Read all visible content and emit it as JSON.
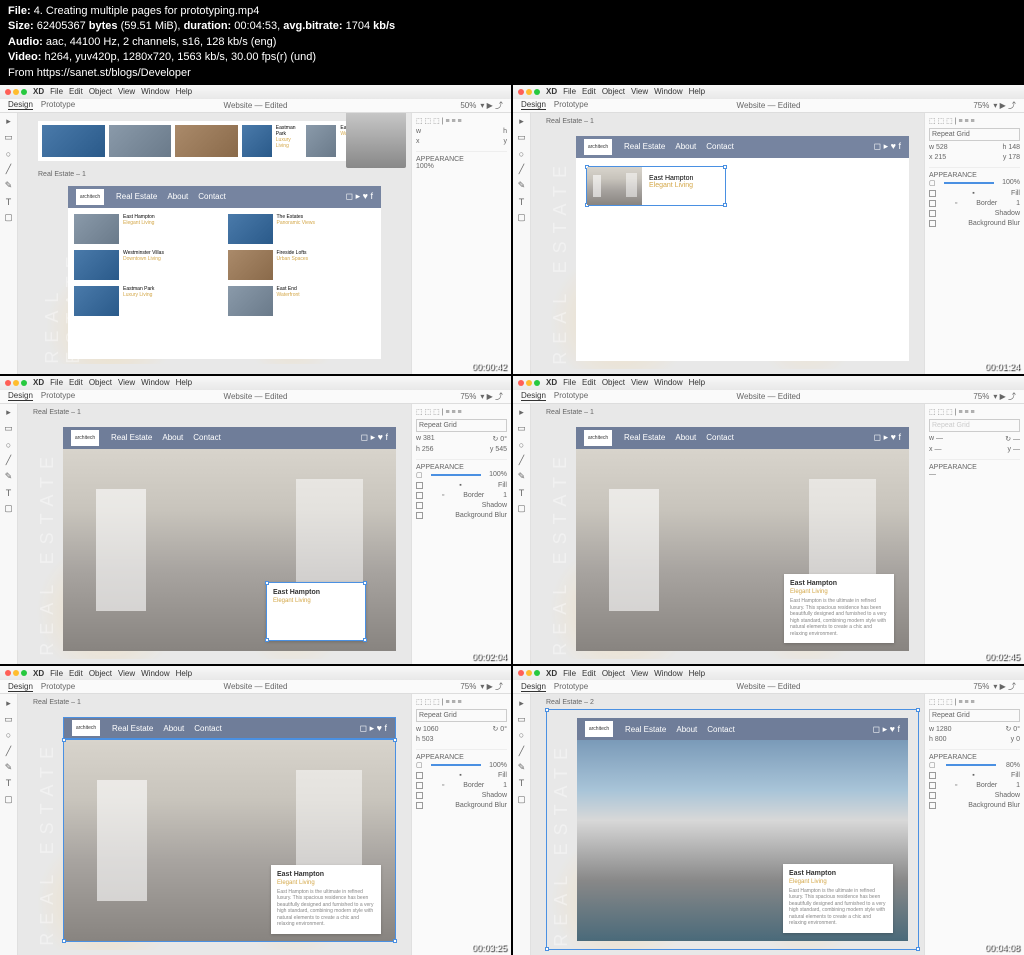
{
  "header": {
    "file_label": "File:",
    "file_name": "4. Creating multiple pages for prototyping.mp4",
    "size_label": "Size:",
    "size_bytes": "62405367",
    "size_unit": "bytes",
    "size_mib": "(59.51 MiB),",
    "duration_label": "duration:",
    "duration": "00:04:53,",
    "bitrate_label": "avg.bitrate:",
    "bitrate": "1704",
    "bitrate_unit": "kb/s",
    "audio_label": "Audio:",
    "audio": "aac, 44100 Hz, 2 channels, s16, 128 kb/s (eng)",
    "video_label": "Video:",
    "video": "h264, yuv420p, 1280x720, 1563 kb/s, 30.00 fps(r) (und)",
    "from": "From https://sanet.st/blogs/Developer"
  },
  "menus": [
    "XD",
    "File",
    "Edit",
    "Object",
    "View",
    "Window",
    "Help"
  ],
  "app": {
    "tab_design": "Design",
    "tab_prototype": "Prototype",
    "title": "Website — Edited"
  },
  "nav": {
    "logo": "architech",
    "links": [
      "Real Estate",
      "About",
      "Contact"
    ]
  },
  "sidebar_text": "REAL ESTATE",
  "card": {
    "title": "East Hampton",
    "subtitle": "Elegant Living",
    "desc": "East Hampton is the ultimate in refined luxury. This spacious residence has been beautifully designed and furnished to a very high standard, combining modern style with natural elements to create a chic and relaxing environment."
  },
  "props": {
    "repeat": "Repeat Grid",
    "appearance": "APPEARANCE",
    "opacity": "100%",
    "fill": "Fill",
    "border": "Border",
    "shadow": "Shadow",
    "blur": "Background Blur"
  },
  "panels": [
    {
      "zoom": "50%",
      "artboard": "Real Estate – 1",
      "ts": "00:00:42",
      "w": "",
      "h": ""
    },
    {
      "zoom": "75%",
      "artboard": "Real Estate – 1",
      "ts": "00:01:24",
      "w": "528",
      "h": "148",
      "x": "215",
      "y": "178"
    },
    {
      "zoom": "75%",
      "artboard": "Real Estate – 1",
      "ts": "00:02:04",
      "w": "381",
      "h": "256",
      "y2": "545"
    },
    {
      "zoom": "75%",
      "artboard": "Real Estate – 1",
      "ts": "00:02:45"
    },
    {
      "zoom": "75%",
      "artboard": "Real Estate – 1",
      "ts": "00:03:25",
      "w": "1060",
      "h": "503"
    },
    {
      "zoom": "75%",
      "artboard": "Real Estate – 2",
      "ts": "00:04:08",
      "w": "1280",
      "h": "800"
    }
  ],
  "grid_items": [
    {
      "name": "East Hampton",
      "sub": "Elegant Living"
    },
    {
      "name": "The Estates",
      "sub": "Panoramic Views"
    },
    {
      "name": "Westminster Villas",
      "sub": "Downtown Living"
    },
    {
      "name": "Fireside Lofts",
      "sub": "Urban Spaces"
    },
    {
      "name": "Eastman Park",
      "sub": "Luxury Living"
    },
    {
      "name": "East End",
      "sub": "Waterfront"
    }
  ]
}
